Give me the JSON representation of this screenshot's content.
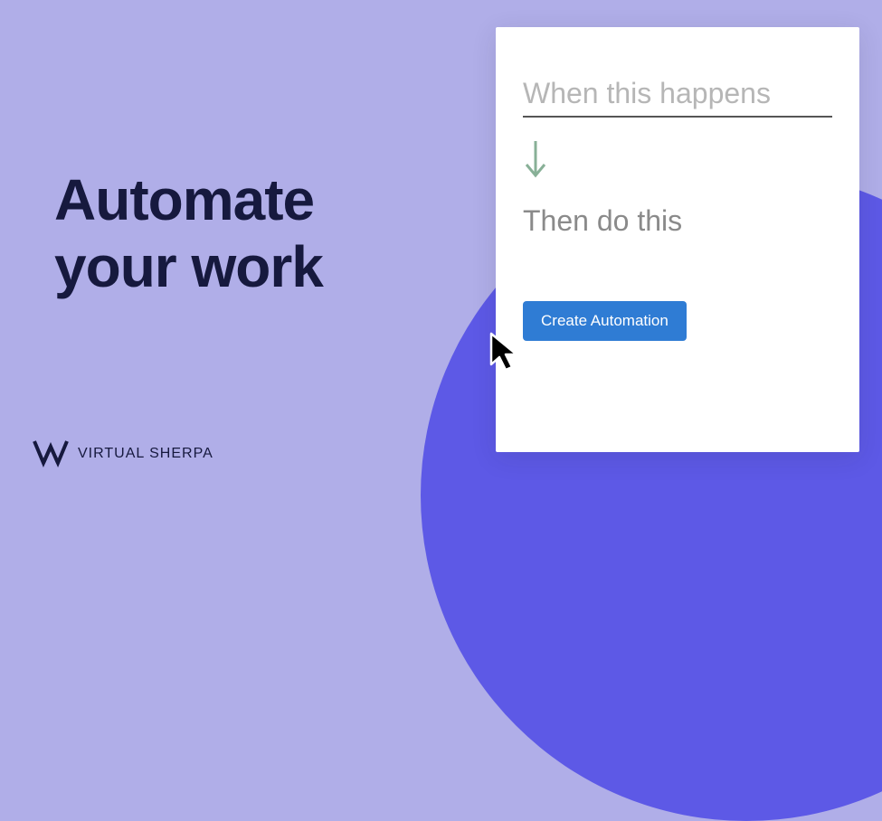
{
  "headline": {
    "line1": "Automate",
    "line2": "your work"
  },
  "brand": {
    "name": "VIRTUAL SHERPA"
  },
  "card": {
    "trigger_placeholder": "When this happens",
    "action_placeholder": "Then do this",
    "create_button_label": "Create Automation"
  },
  "icons": {
    "arrow_down": "arrow-down-icon",
    "cursor": "cursor-icon",
    "brand_mark": "virtual-sherpa-logo"
  },
  "colors": {
    "background": "#b0aee8",
    "accent_blob": "#5d59e6",
    "headline": "#16193e",
    "button": "#2f7cd4",
    "arrow": "#88b097"
  }
}
